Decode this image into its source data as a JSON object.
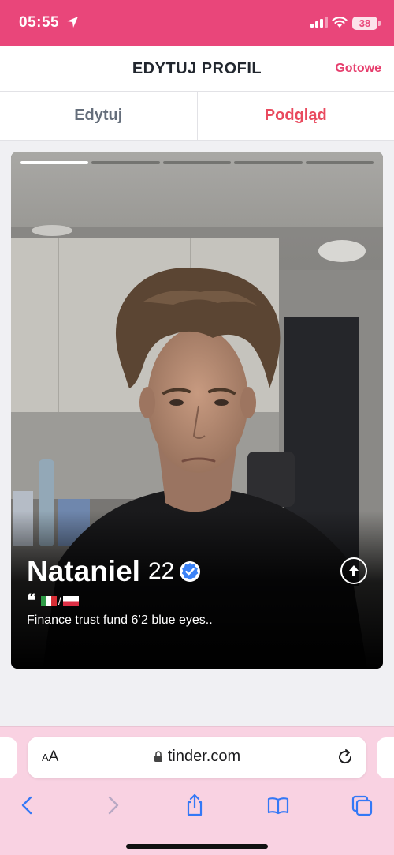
{
  "status_bar": {
    "time": "05:55",
    "battery": "38"
  },
  "header": {
    "title": "EDYTUJ PROFIL",
    "done_label": "Gotowe"
  },
  "tabs": [
    {
      "label": "Edytuj",
      "active": false
    },
    {
      "label": "Podgląd",
      "active": true
    }
  ],
  "profile": {
    "name": "Nataniel",
    "age": "22",
    "verified": true,
    "bio": "Finance trust fund 6’2 blue eyes..",
    "flags": [
      "italy-flag",
      "poland-flag"
    ],
    "flag_separator": "/",
    "photo_count": 5,
    "current_photo": 1
  },
  "browser": {
    "aa_label_small": "A",
    "aa_label_large": "A",
    "url": "tinder.com"
  },
  "colors": {
    "brand": "#e9467a",
    "accent": "#e94a5e",
    "verified": "#3b82f6"
  }
}
